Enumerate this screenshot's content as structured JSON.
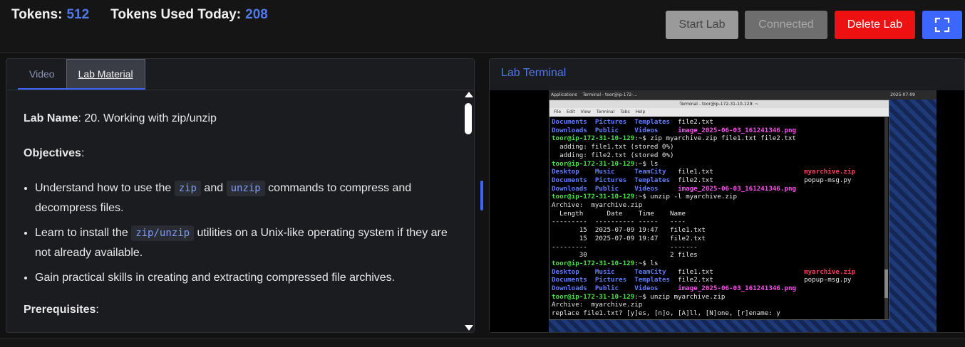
{
  "header": {
    "tokens_label": "Tokens:",
    "tokens_value": "512",
    "used_label": "Tokens Used Today:",
    "used_value": "208"
  },
  "buttons": {
    "start": "Start Lab",
    "connected": "Connected",
    "delete": "Delete Lab",
    "fullscreen_icon": "fullscreen-icon"
  },
  "tabs": [
    {
      "label": "Video",
      "active": false
    },
    {
      "label": "Lab Material",
      "active": true
    }
  ],
  "material": {
    "lab_name_label": "Lab Name",
    "lab_name_value": ": 20. Working with zip/unzip",
    "objectives_label": "Objectives",
    "bullets": [
      {
        "pre": "Understand how to use the ",
        "code1": "zip",
        "mid": " and ",
        "code2": "unzip",
        "post": " commands to compress and decompress files."
      },
      {
        "pre": "Learn to install the ",
        "code1": "zip/unzip",
        "post": " utilities on a Unix-like operating system if they are not already available."
      },
      {
        "pre": "Gain practical skills in creating and extracting compressed file archives."
      }
    ],
    "prerequisites_label": "Prerequisites"
  },
  "terminal_panel": {
    "title": "Lab Terminal",
    "window_title": "Terminal - toor@ip-172-31-10-129: ~",
    "taskbar_apps": "Applications",
    "taskbar_task": "Terminal - toor@ip-172-...",
    "taskbar_time": "2025-07-09",
    "menu": [
      "File",
      "Edit",
      "View",
      "Terminal",
      "Tabs",
      "Help"
    ],
    "prompt": "toor@ip-172-31-10-129:~$"
  },
  "colors": {
    "accent": "#3d66ff",
    "danger": "#ee1111",
    "prompt_green": "#4ee04e",
    "dir_blue": "#5f7cff",
    "png_magenta": "#ff4df0",
    "zip_red": "#ff3b5c"
  }
}
